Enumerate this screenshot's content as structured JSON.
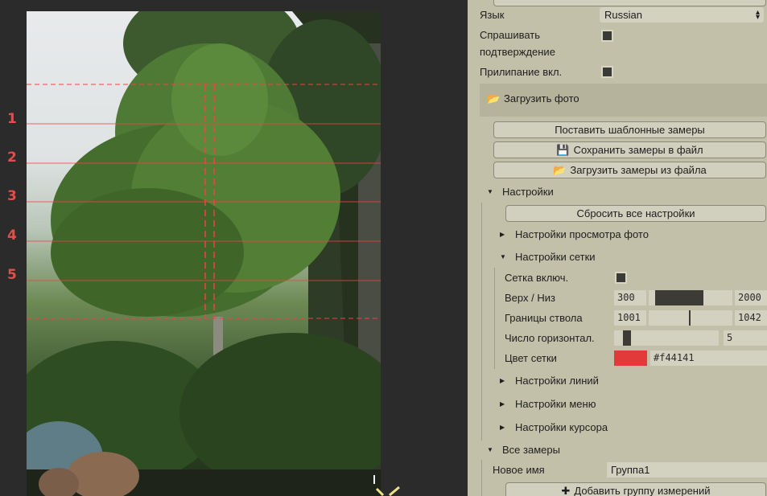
{
  "rows": [
    "1",
    "2",
    "3",
    "4",
    "5"
  ],
  "settings": {
    "language_label": "Язык",
    "language_value": "Russian",
    "ask_confirm_label": "Спрашивать подтверждение",
    "ask_confirm_line1": "Спрашивать",
    "ask_confirm_line2": "подтверждение",
    "snap_label": "Прилипание вкл.",
    "load_photo": "Загрузить фото",
    "set_template": "Поставить шаблонные замеры",
    "save_measures": "Сохранить замеры в файл",
    "load_measures": "Загрузить замеры из файла",
    "settings_section": "Настройки",
    "reset_all": "Сбросить все настройки",
    "photo_view_settings": "Настройки просмотра фото",
    "grid_settings": "Настройки сетки",
    "grid_on_label": "Сетка включ.",
    "top_bottom_label": "Верх / Низ",
    "top_value": "300",
    "bottom_value": "2000",
    "trunk_label": "Границы ствола",
    "trunk_left_value": "1001",
    "trunk_right_value": "1042",
    "horiz_count_label": "Число горизонтал.",
    "horiz_count_value": "5",
    "grid_color_label": "Цвет сетки",
    "grid_color_value": "#f44141",
    "line_settings": "Настройки линий",
    "menu_settings": "Настройки меню",
    "cursor_settings": "Настройки курсора",
    "all_measures": "Все замеры",
    "new_name_label": "Новое имя",
    "new_name_value": "Группа1",
    "add_group": "Добавить группу измерений"
  },
  "colors": {
    "grid": "#f44141",
    "panel": "#c3c0a9",
    "viewer_bg": "#2b2b2b"
  }
}
